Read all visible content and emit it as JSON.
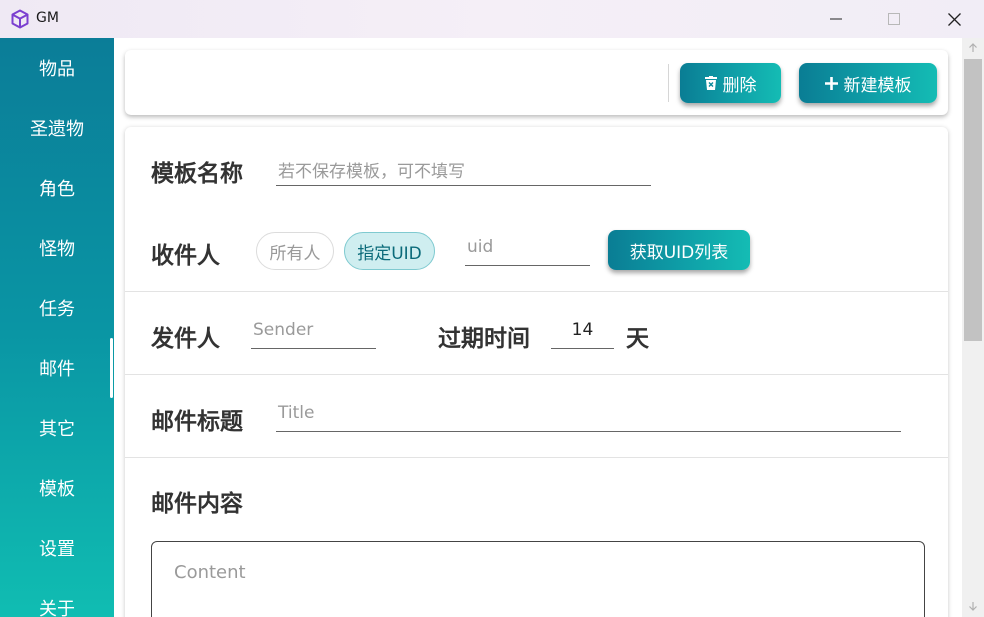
{
  "window": {
    "title": "GM"
  },
  "sidebar": {
    "items": [
      {
        "label": "物品"
      },
      {
        "label": "圣遗物"
      },
      {
        "label": "角色"
      },
      {
        "label": "怪物"
      },
      {
        "label": "任务"
      },
      {
        "label": "邮件",
        "active": true
      },
      {
        "label": "其它"
      },
      {
        "label": "模板"
      },
      {
        "label": "设置"
      },
      {
        "label": "关于"
      }
    ]
  },
  "toolbar": {
    "delete_label": "删除",
    "new_template_label": "新建模板"
  },
  "form": {
    "template_name": {
      "label": "模板名称",
      "placeholder": "若不保存模板，可不填写",
      "value": ""
    },
    "recipient": {
      "label": "收件人",
      "options": [
        "所有人",
        "指定UID"
      ],
      "selected": "指定UID",
      "uid_placeholder": "uid",
      "fetch_button": "获取UID列表"
    },
    "sender": {
      "label": "发件人",
      "placeholder": "Sender"
    },
    "expiry": {
      "label": "过期时间",
      "value": "14",
      "unit": "天"
    },
    "title": {
      "label": "邮件标题",
      "placeholder": "Title"
    },
    "content": {
      "label": "邮件内容",
      "placeholder": "Content"
    }
  },
  "colors": {
    "accent_start": "#0a7d94",
    "accent_end": "#14bcb4",
    "app_icon": "#7b3fd0"
  }
}
